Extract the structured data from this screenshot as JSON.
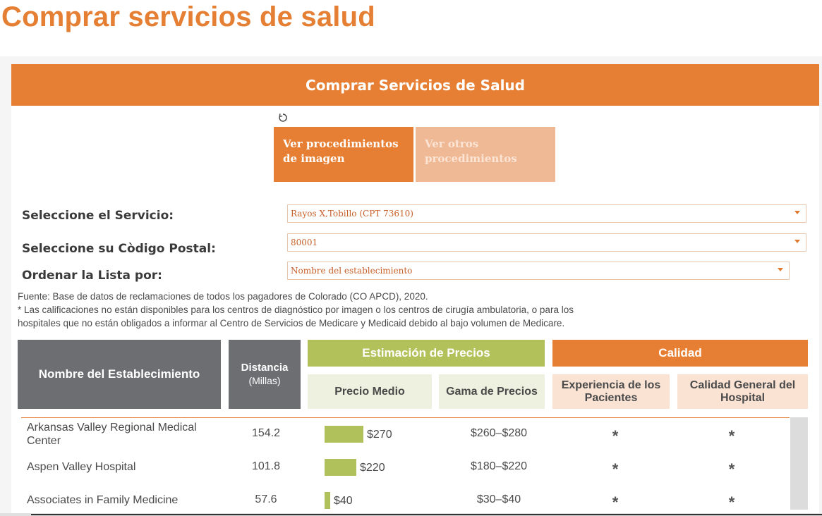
{
  "page_title": "Comprar servicios de salud",
  "banner_title": "Comprar Servicios de Salud",
  "tabs": {
    "active": "Ver procedimientos de imagen",
    "inactive": "Ver otros procedimientos"
  },
  "filters": {
    "service": {
      "label": "Seleccione el Servicio:",
      "value": "Rayos X,Tobillo (CPT 73610)"
    },
    "zip": {
      "label": "Seleccione su Còdigo Postal:",
      "value": "80001"
    },
    "sort": {
      "label": "Ordenar la Lista por:",
      "value": "Nombre del establecimiento"
    }
  },
  "notes": {
    "source": "Fuente: Base de datos de reclamaciones de todos los pagadores de Colorado (CO APCD), 2020.",
    "footnote_line1": "* Las calificaciones no están disponibles para los centros de diagnóstico por imagen o los centros de cirugía ambulatoria, o para los",
    "footnote_line2": "hospitales que no están obligados a informar al Centro de Servicios de Medicare y Medicaid debido al bajo volumen de Medicare."
  },
  "table": {
    "col_name": "Nombre del Establecimiento",
    "col_distance": "Distancia",
    "col_distance_unit": "(Millas)",
    "group_price": "Estimación de Precios",
    "col_median": "Precio Medio",
    "col_range": "Gama de Precios",
    "group_quality": "Calidad",
    "col_experience": "Experiencia de los Pacientes",
    "col_rating": "Calidad General del Hospital",
    "rows": [
      {
        "name": "Arkansas Valley Regional Medical Center",
        "distance": "154.2",
        "price_label": "$270",
        "price": 270,
        "range": "$260–$280",
        "experience": "*",
        "rating": "*"
      },
      {
        "name": "Aspen Valley Hospital",
        "distance": "101.8",
        "price_label": "$220",
        "price": 220,
        "range": "$180–$220",
        "experience": "*",
        "rating": "*"
      },
      {
        "name": "Associates in Family Medicine",
        "distance": "57.6",
        "price_label": "$40",
        "price": 40,
        "range": "$30–$40",
        "experience": "*",
        "rating": "*"
      }
    ]
  },
  "colors": {
    "brand_orange": "#e67f33",
    "price_green": "#b0c05a",
    "header_gray": "#6d6e71"
  },
  "icons": {
    "reset": "reset-icon",
    "dropdown": "chevron-down-icon"
  }
}
